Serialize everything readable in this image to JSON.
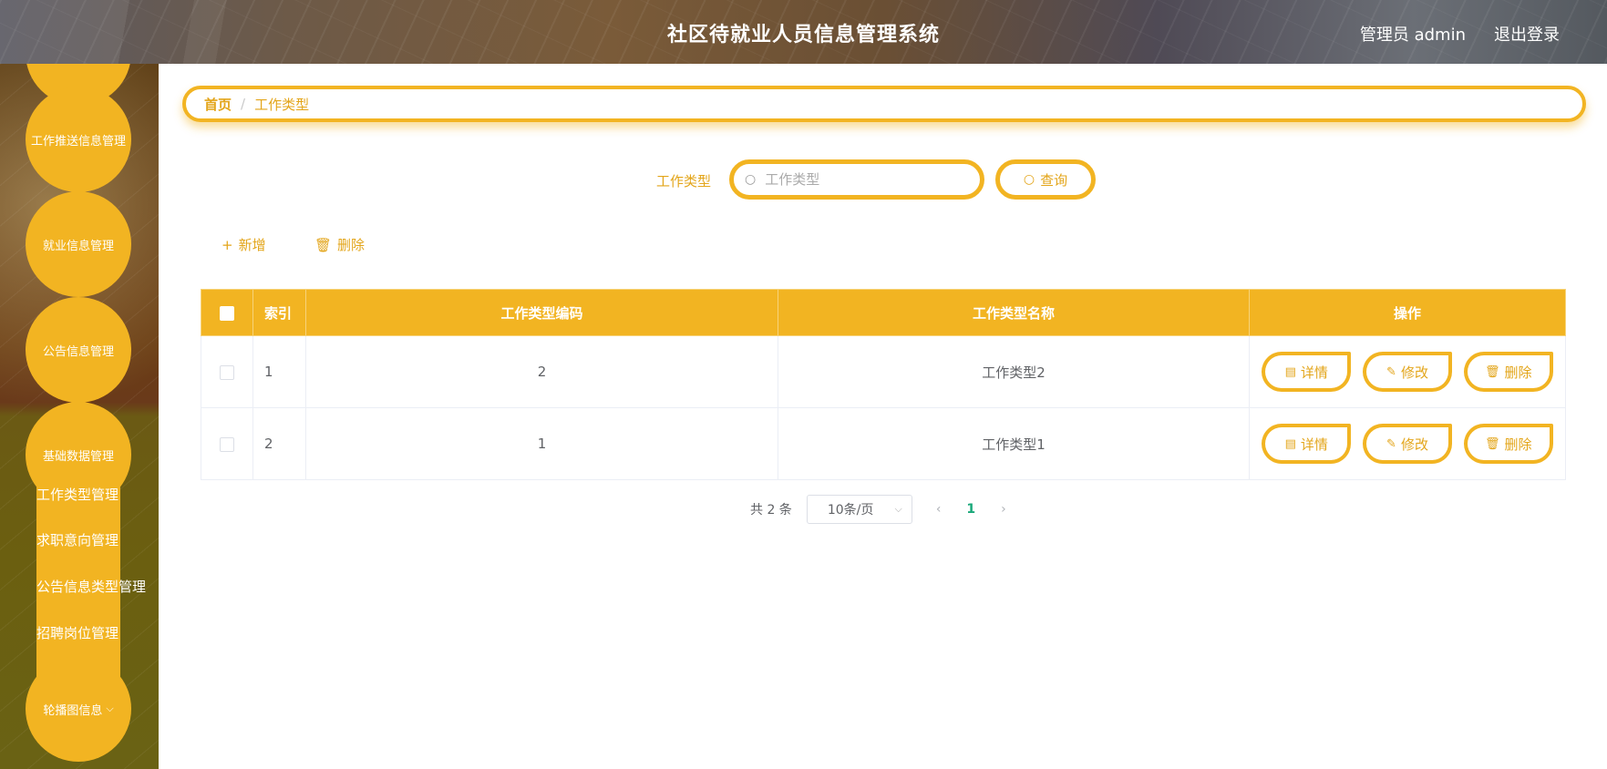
{
  "header": {
    "title": "社区待就业人员信息管理系统",
    "user": "管理员 admin",
    "logout": "退出登录"
  },
  "sidebar": {
    "items": [
      {
        "label": "工作推送信息管理"
      },
      {
        "label": "就业信息管理"
      },
      {
        "label": "公告信息管理"
      },
      {
        "label": "基础数据管理"
      },
      {
        "label": "轮播图信息"
      }
    ],
    "submenu": [
      {
        "label": "工作类型管理"
      },
      {
        "label": "求职意向管理"
      },
      {
        "label": "公告信息类型管理"
      },
      {
        "label": "招聘岗位管理"
      }
    ]
  },
  "breadcrumb": {
    "home": "首页",
    "separator": "/",
    "current": "工作类型"
  },
  "search": {
    "label": "工作类型",
    "placeholder": "工作类型",
    "value": "",
    "button": "查询"
  },
  "toolbar": {
    "add": "新增",
    "delete": "删除"
  },
  "table": {
    "headers": [
      "索引",
      "工作类型编码",
      "工作类型名称",
      "操作"
    ],
    "rows": [
      {
        "index": "1",
        "code": "2",
        "name": "工作类型2"
      },
      {
        "index": "2",
        "code": "1",
        "name": "工作类型1"
      }
    ],
    "actions": {
      "detail": "详情",
      "edit": "修改",
      "delete": "删除"
    }
  },
  "pagination": {
    "total": "共 2 条",
    "page_size": "10条/页",
    "current_page": "1"
  },
  "colors": {
    "accent": "#f2b422",
    "accent_text": "#e3a51a",
    "active_page": "#1aa87a"
  }
}
